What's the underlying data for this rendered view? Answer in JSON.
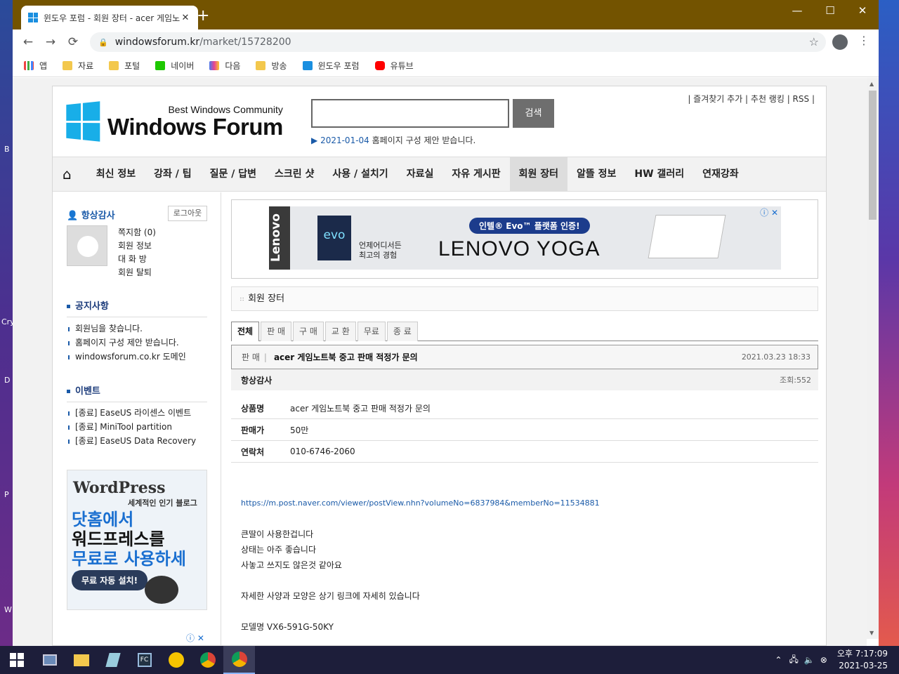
{
  "desktop": {
    "left_glyphs": [
      "B",
      "Cry",
      "D",
      "P",
      "W"
    ]
  },
  "browser": {
    "tab": {
      "title": "윈도우 포럼 - 회원 장터 - acer 게임노트북 중고 판매 적정가 문의",
      "close": "✕"
    },
    "new_tab": "+",
    "window_controls": {
      "minimize": "—",
      "maximize": "☐",
      "close": "✕"
    },
    "nav": {
      "back": "←",
      "forward": "→",
      "reload": "⟳"
    },
    "url": {
      "host": "windowsforum.kr",
      "path": "/market/15728200"
    },
    "star": "☆",
    "menu": "⋮",
    "bookmarks": [
      "앱",
      "자료",
      "포털",
      "네이버",
      "다음",
      "방송",
      "윈도우 포럼",
      "유튜브"
    ]
  },
  "site": {
    "logo": {
      "tagline": "Best Windows Community",
      "name": "Windows Forum"
    },
    "search": {
      "value": "",
      "button": "검색"
    },
    "notice": {
      "arrow": "▶",
      "date": "2021-01-04",
      "text": " 홈페이지 구성 제안 받습니다."
    },
    "toplinks": "| 즐겨찾기 추가 | 추천 랭킹 | RSS |",
    "gnb": [
      "최신 정보",
      "강좌 / 팁",
      "질문 / 답변",
      "스크린 샷",
      "사용 / 설치기",
      "자료실",
      "자유 게시판",
      "회원 장터",
      "알뜰 정보",
      "HW 갤러리",
      "연재강좌"
    ],
    "gnb_active": "회원 장터"
  },
  "sidebar": {
    "user": "항상감사",
    "logout": "로그아웃",
    "user_menu": [
      "쪽지함 (0)",
      "회원 정보",
      "대 화 방",
      "회원 탈퇴"
    ],
    "notices_title": "공지사항",
    "notices": [
      "회원님을 찾습니다.",
      "홈페이지 구성 제안 받습니다.",
      "windowsforum.co.kr 도메인"
    ],
    "events_title": "이벤트",
    "events": [
      "[종료] EaseUS 라이센스 이벤트",
      "[종료] MiniTool partition",
      "[종료] EaseUS Data Recovery"
    ],
    "ad": {
      "brand": "WordPress",
      "sub": "세계적인 인기 블로그",
      "line1": "닷홈에서",
      "line2": "워드프레스를",
      "line3": "무료로 사용하세요!",
      "button": "무료 자동 설치!"
    }
  },
  "banner": {
    "brand": "Lenovo",
    "evo_badge": "evo",
    "tagline1": "언제어디서든",
    "tagline2": "최고의 경험",
    "pill": "인텔® Evo™ 플랫폼 인증!",
    "headline": "LENOVO YOGA"
  },
  "board": {
    "title": "회원 장터",
    "tabs": [
      "전체",
      "판 매",
      "구 매",
      "교 환",
      "무료",
      "종 료"
    ],
    "active_tab": "전체",
    "post": {
      "category": "판 매",
      "title": "acer 게임노트북 중고 판매 적정가 문의",
      "date": "2021.03.23 18:33",
      "author": "항상감사",
      "views": "조회:552"
    },
    "fields": [
      {
        "label": "상품명",
        "value": "acer 게임노트북 중고 판매 적정가 문의"
      },
      {
        "label": "판매가",
        "value": "50만"
      },
      {
        "label": "연락처",
        "value": "010-6746-2060"
      }
    ],
    "body": {
      "link": "https://m.post.naver.com/viewer/postView.nhn?volumeNo=6837984&memberNo=11534881",
      "lines": [
        "큰딸이 사용한겁니다",
        "상태는 아주 좋습니다",
        "사놓고 쓰지도 않은것 같아요",
        "",
        "자세한 사양과 모양은 상기 링크에 자세히 있습니다",
        "",
        "모델명 VX6-591G-50KY"
      ]
    }
  },
  "taskbar": {
    "time": "오후 7:17:09",
    "date": "2021-03-25"
  }
}
